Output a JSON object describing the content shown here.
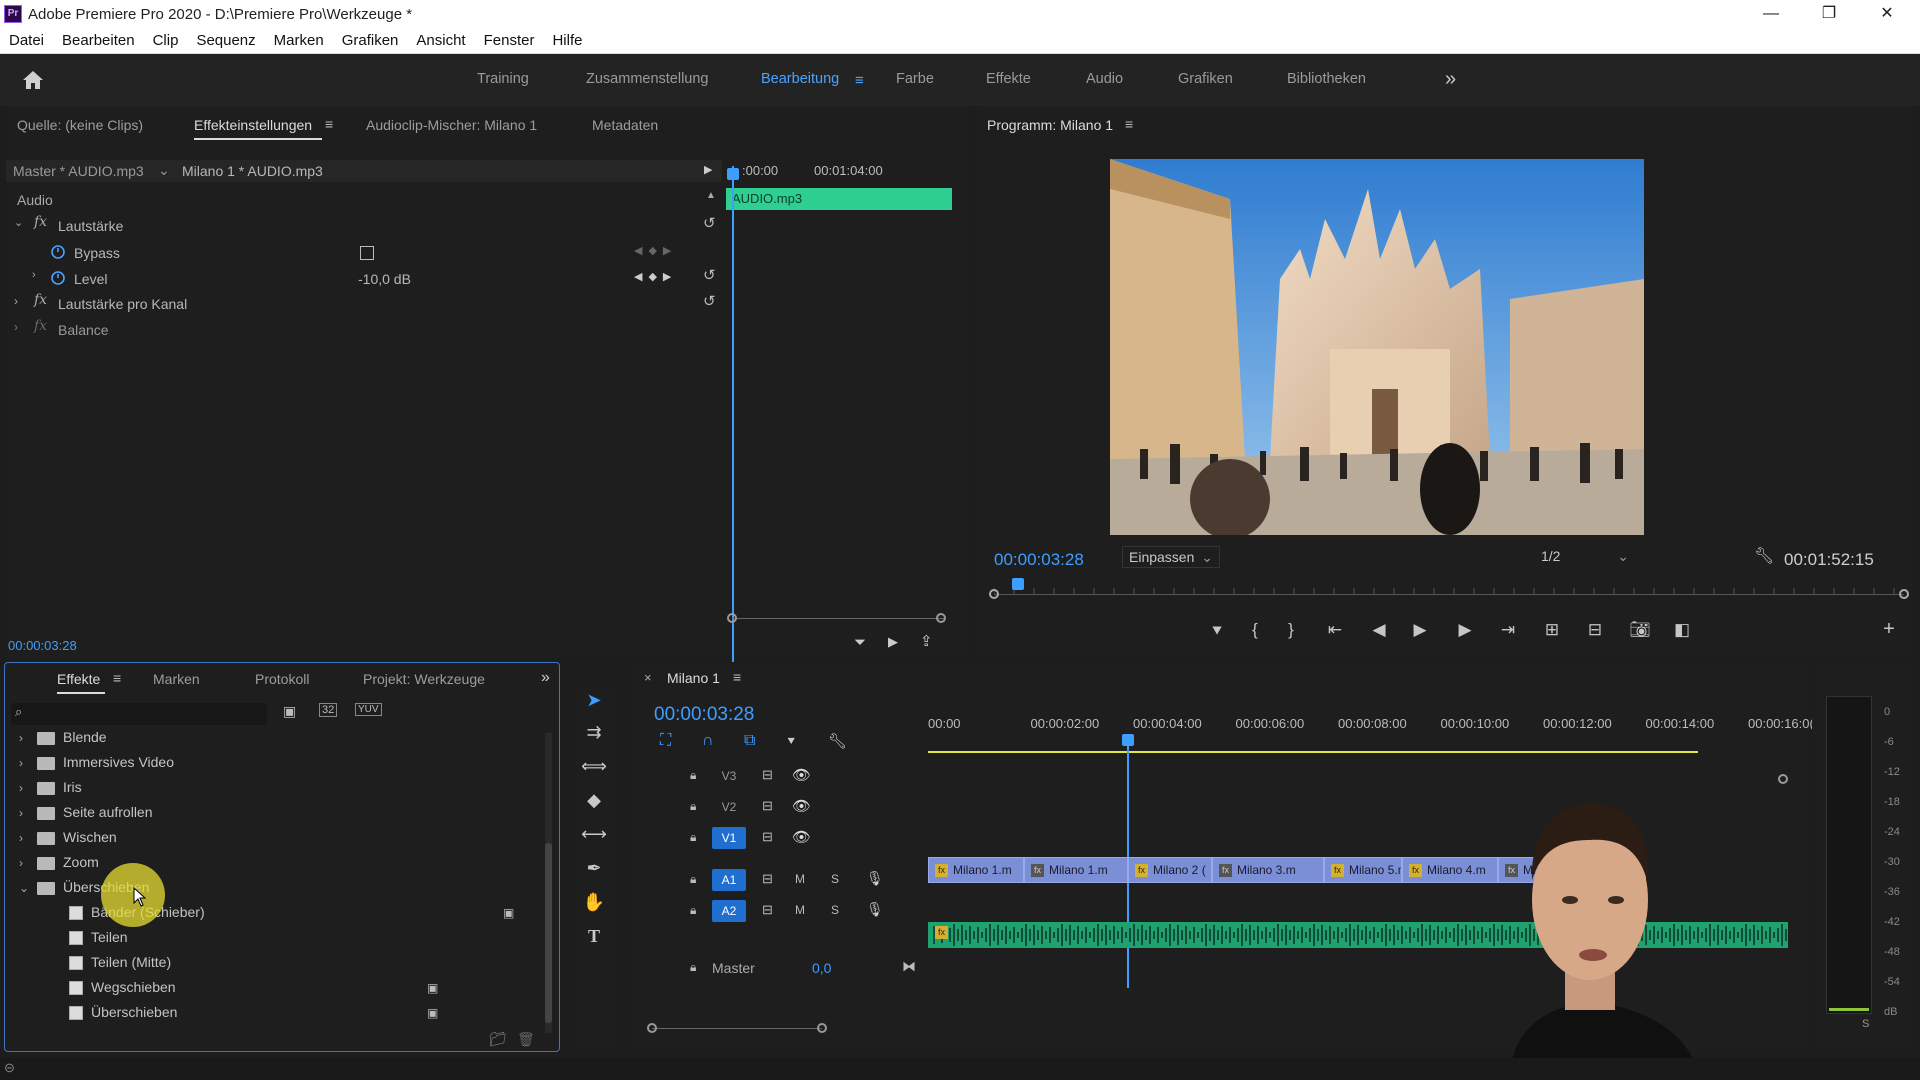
{
  "app": {
    "title": "Adobe Premiere Pro 2020 - D:\\Premiere Pro\\Werkzeuge *",
    "icon_text": "Pr"
  },
  "window_controls": {
    "minimize": "—",
    "restore": "❐",
    "close": "✕"
  },
  "menu": [
    "Datei",
    "Bearbeiten",
    "Clip",
    "Sequenz",
    "Marken",
    "Grafiken",
    "Ansicht",
    "Fenster",
    "Hilfe"
  ],
  "workspaces": {
    "items": [
      "Training",
      "Zusammenstellung",
      "Bearbeitung",
      "Farbe",
      "Effekte",
      "Audio",
      "Grafiken",
      "Bibliotheken"
    ],
    "active": "Bearbeitung",
    "more": "»"
  },
  "source_panel": {
    "tabs": [
      "Quelle: (keine Clips)",
      "Effekteinstellungen",
      "Audioclip-Mischer: Milano 1",
      "Metadaten"
    ],
    "active_tab": "Effekteinstellungen",
    "master_label": "Master * AUDIO.mp3",
    "clip_label": "Milano 1 * AUDIO.mp3",
    "section": "Audio",
    "effects": [
      {
        "name": "Lautstärke"
      },
      {
        "name": "Bypass"
      },
      {
        "name": "Level",
        "value": "-10,0 dB"
      },
      {
        "name": "Lautstärke pro Kanal"
      },
      {
        "name": "Balance"
      }
    ],
    "mini_timeline": {
      "t0": ":00:00",
      "t1": "00:01:04:00",
      "clip": "AUDIO.mp3"
    },
    "timecode": "00:00:03:28"
  },
  "program_monitor": {
    "title": "Programm: Milano 1",
    "timecode": "00:00:03:28",
    "fit": "Einpassen",
    "resolution": "1/2",
    "duration": "00:01:52:15",
    "playhead_fraction": 0.026
  },
  "effects_panel": {
    "tabs": [
      "Effekte",
      "Marken",
      "Protokoll",
      "Projekt: Werkzeuge"
    ],
    "active_tab": "Effekte",
    "folders": [
      "Blende",
      "Immersives Video",
      "Iris",
      "Seite aufrollen",
      "Wischen",
      "Zoom",
      "Überschieben"
    ],
    "open_folder": "Überschieben",
    "presets": [
      "Bänder (Schieber)",
      "Teilen",
      "Teilen (Mitte)",
      "Wegschieben",
      "Überschieben"
    ]
  },
  "timeline": {
    "tab": "Milano 1",
    "timecode": "00:00:03:28",
    "ruler": [
      "00:00",
      "00:00:02:00",
      "00:00:04:00",
      "00:00:06:00",
      "00:00:08:00",
      "00:00:10:00",
      "00:00:12:00",
      "00:00:14:00",
      "00:00:16:0("
    ],
    "video_tracks": [
      "V3",
      "V2",
      "V1"
    ],
    "audio_tracks": [
      "A1",
      "A2"
    ],
    "track_buttons": {
      "mute": "M",
      "solo": "S"
    },
    "master": {
      "label": "Master",
      "value": "0,0"
    },
    "clips": [
      {
        "label": "Milano 1.m",
        "fx": true
      },
      {
        "label": "Milano 1.m",
        "fx": false
      },
      {
        "label": "Milano 2 (",
        "fx": true
      },
      {
        "label": "Milano 3.m",
        "fx": false
      },
      {
        "label": "Milano 5.m",
        "fx": true
      },
      {
        "label": "Milano 4.m",
        "fx": true
      },
      {
        "label": "Milano 4.mp4",
        "fx": false
      }
    ]
  },
  "audio_meter": {
    "labels": [
      "0",
      "-6",
      "-12",
      "-18",
      "-24",
      "-30",
      "-36",
      "-42",
      "-48",
      "-54",
      "dB"
    ],
    "solo": "S"
  },
  "colors": {
    "accent": "#3d9eff",
    "audio_clip": "#2fcf92",
    "video_clip": "#7b8fd6",
    "fx_badge": "#d4b030"
  }
}
